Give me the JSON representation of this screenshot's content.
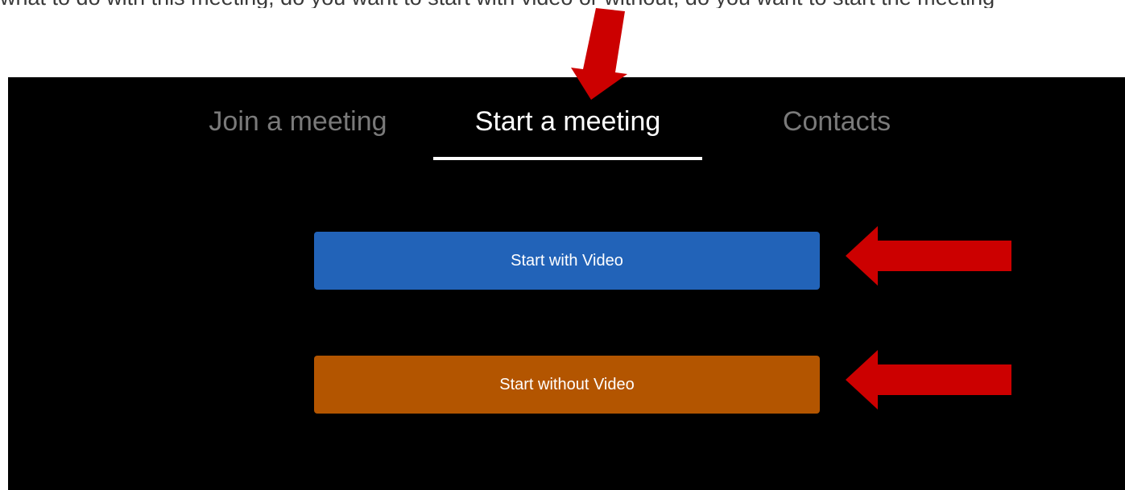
{
  "top_text": "what to do with this meeting, do you want to start with video or without, do you want to start the meeting",
  "tabs": [
    {
      "label": "Join a meeting",
      "active": false
    },
    {
      "label": "Start a meeting",
      "active": true
    },
    {
      "label": "Contacts",
      "active": false
    }
  ],
  "buttons": {
    "start_with_video": "Start with Video",
    "start_without_video": "Start without Video"
  },
  "colors": {
    "background": "#000000",
    "active_tab": "#ffffff",
    "inactive_tab": "#7a7a7a",
    "video_button": "#2263b8",
    "no_video_button": "#b35500",
    "annotation_arrow": "#cc0000"
  },
  "annotations": {
    "icon": "red-arrow-icon"
  }
}
